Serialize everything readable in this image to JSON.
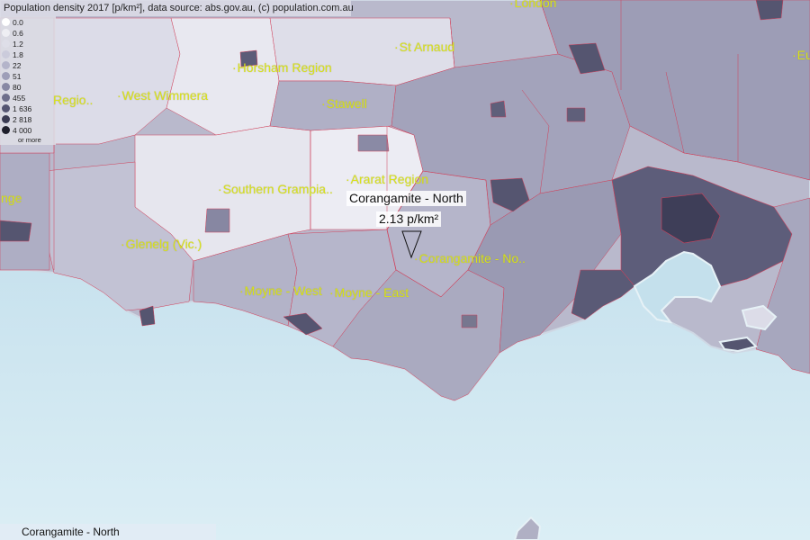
{
  "header": {
    "title": "Population density 2017 [p/km²], data source: abs.gov.au, (c) population.com.au"
  },
  "legend": {
    "items": [
      {
        "label": "0.0",
        "color": "#ffffff"
      },
      {
        "label": "0.6",
        "color": "#eeeef3"
      },
      {
        "label": "1.2",
        "color": "#dedee8"
      },
      {
        "label": "1.8",
        "color": "#cbcbdb"
      },
      {
        "label": "22",
        "color": "#b4b4ca"
      },
      {
        "label": "51",
        "color": "#9e9eb8"
      },
      {
        "label": "80",
        "color": "#8888a4"
      },
      {
        "label": "455",
        "color": "#6e6e8b"
      },
      {
        "label": "1 636",
        "color": "#555572"
      },
      {
        "label": "2 818",
        "color": "#3a3a52"
      },
      {
        "label": "4 000",
        "color": "#1f1f2c"
      }
    ],
    "note": "or more"
  },
  "places": [
    {
      "name": "London"
    },
    {
      "name": "St Arnaud"
    },
    {
      "name": "Horsham Region"
    },
    {
      "name": "West Wimmera"
    },
    {
      "name": "Regio.."
    },
    {
      "name": "Stawell"
    },
    {
      "name": "Ararat Region"
    },
    {
      "name": "Southern Grampia.."
    },
    {
      "name": "Glenelg (Vic.)"
    },
    {
      "name": "nge"
    },
    {
      "name": "Moyne - West"
    },
    {
      "name": "Moyne - East"
    },
    {
      "name": "Corangamite - No.."
    },
    {
      "name": "Eu"
    }
  ],
  "callout": {
    "name": "Corangamite - North",
    "value": "2.13 p/km²"
  },
  "status": {
    "selected": "Corangamite - North"
  },
  "colors": {
    "sea": "#cfe6ef",
    "border": "#d0405a",
    "label": "#d9e21a"
  }
}
